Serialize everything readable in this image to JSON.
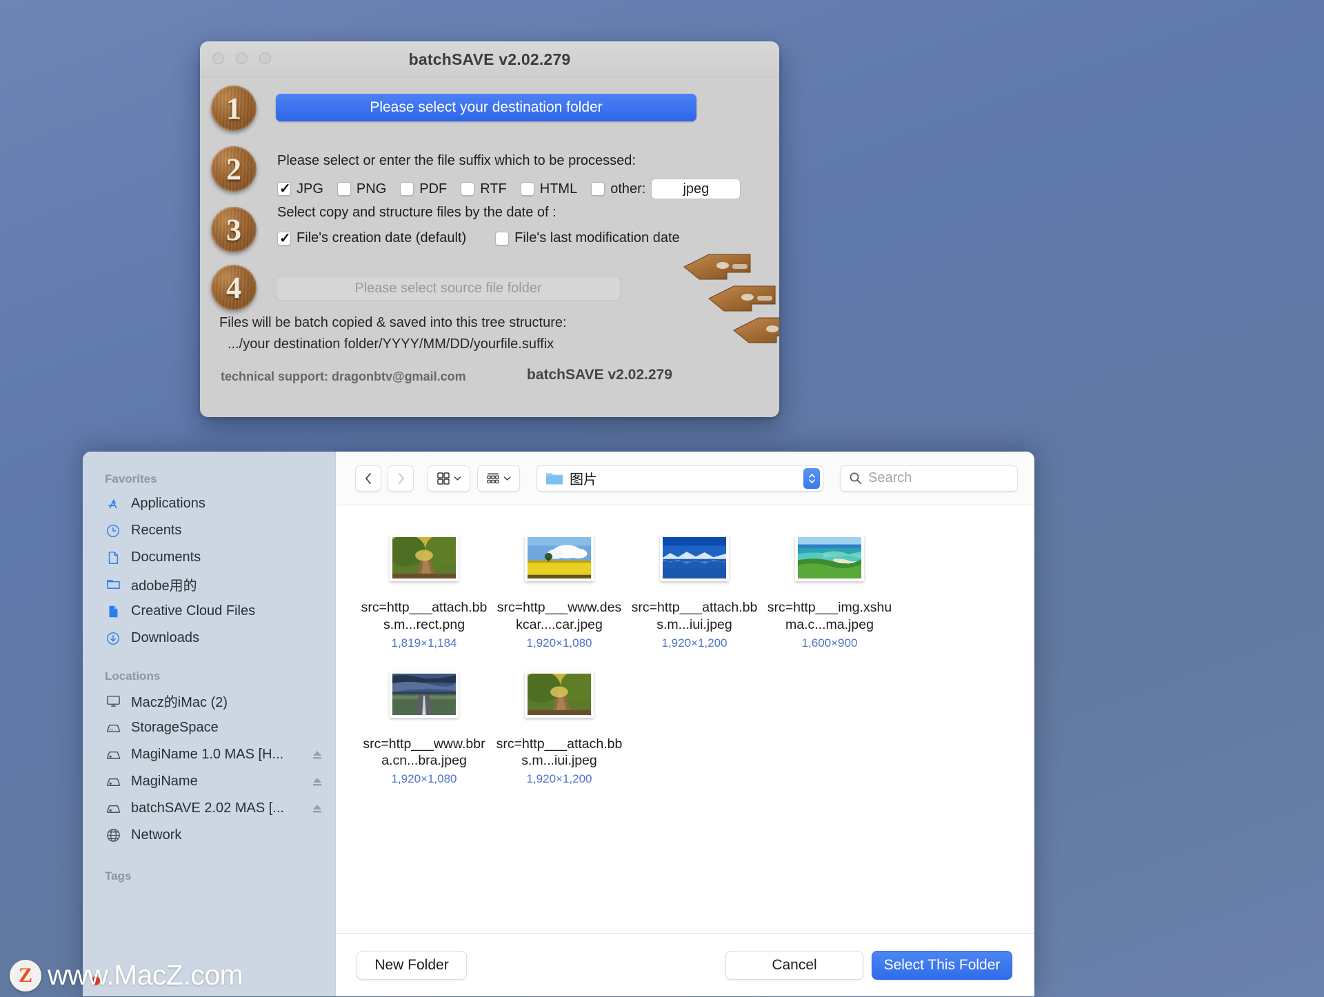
{
  "desktop": {
    "background": "#62789f"
  },
  "batchsave": {
    "title": "batchSAVE  v2.02.279",
    "steps": {
      "one": "1",
      "two": "2",
      "three": "3",
      "four": "4"
    },
    "destination_button": "Please select your destination folder",
    "suffix_label": "Please select or enter the file suffix which to be processed:",
    "suffix_options": [
      {
        "label": "JPG",
        "checked": true
      },
      {
        "label": "PNG",
        "checked": false
      },
      {
        "label": "PDF",
        "checked": false
      },
      {
        "label": "RTF",
        "checked": false
      },
      {
        "label": "HTML",
        "checked": false
      }
    ],
    "other_label": "other:",
    "other_value": "jpeg",
    "date_label": "Select copy and structure files by the date of :",
    "date_options": [
      {
        "label": "File's creation date (default)",
        "checked": true
      },
      {
        "label": "File's last modification date",
        "checked": false
      }
    ],
    "source_button": "Please select source file folder",
    "tree_line1": "Files will be batch copied & saved into this tree structure:",
    "tree_line2": ".../your destination folder/YYYY/MM/DD/yourfile.suffix",
    "support": "technical support:  dragonbtv@gmail.com",
    "version": "batchSAVE  v2.02.279",
    "accent": "#2f66e8"
  },
  "finder": {
    "sidebar": {
      "favorites_header": "Favorites",
      "favorites": [
        {
          "label": "Applications",
          "icon": "appstore-icon"
        },
        {
          "label": "Recents",
          "icon": "clock-icon"
        },
        {
          "label": "Documents",
          "icon": "document-icon"
        },
        {
          "label": "adobe用的",
          "icon": "folder-icon"
        },
        {
          "label": "Creative Cloud Files",
          "icon": "document-filled-icon"
        },
        {
          "label": "Downloads",
          "icon": "download-icon"
        }
      ],
      "locations_header": "Locations",
      "locations": [
        {
          "label": "Macz的iMac (2)",
          "icon": "imac-icon",
          "eject": false
        },
        {
          "label": "StorageSpace",
          "icon": "drive-icon",
          "eject": false
        },
        {
          "label": "MagiName 1.0 MAS [H...",
          "icon": "drive-icon",
          "eject": true
        },
        {
          "label": "MagiName",
          "icon": "drive-icon",
          "eject": true
        },
        {
          "label": "batchSAVE 2.02 MAS [...",
          "icon": "drive-icon",
          "eject": true
        },
        {
          "label": "Network",
          "icon": "globe-icon",
          "eject": false
        }
      ],
      "tags_header": "Tags"
    },
    "toolbar": {
      "back_icon": "chevron-left-icon",
      "forward_icon": "chevron-right-icon",
      "view_icon": "grid-view-icon",
      "group_icon": "group-view-icon",
      "path_label": "图片",
      "search_placeholder": "Search"
    },
    "files": [
      {
        "name": "src=http___attach.bbs.m...rect.png",
        "dims": "1,819×1,184",
        "thumb": "autumn-road"
      },
      {
        "name": "src=http___www.deskcar....car.jpeg",
        "dims": "1,920×1,080",
        "thumb": "canola-field"
      },
      {
        "name": "src=http___attach.bbs.m...iui.jpeg",
        "dims": "1,920×1,200",
        "thumb": "blue-lake"
      },
      {
        "name": "src=http___img.xshuma.c...ma.jpeg",
        "dims": "1,600×900",
        "thumb": "tropical-coast"
      },
      {
        "name": "src=http___www.bbra.cn...bra.jpeg",
        "dims": "1,920×1,080",
        "thumb": "storm-road"
      },
      {
        "name": "src=http___attach.bbs.m...iui.jpeg",
        "dims": "1,920×1,200",
        "thumb": "autumn-road"
      }
    ],
    "footer": {
      "new_folder": "New Folder",
      "cancel": "Cancel",
      "select": "Select This Folder"
    }
  },
  "watermark": {
    "logo": "Z",
    "text": "www.MacZ.com"
  }
}
